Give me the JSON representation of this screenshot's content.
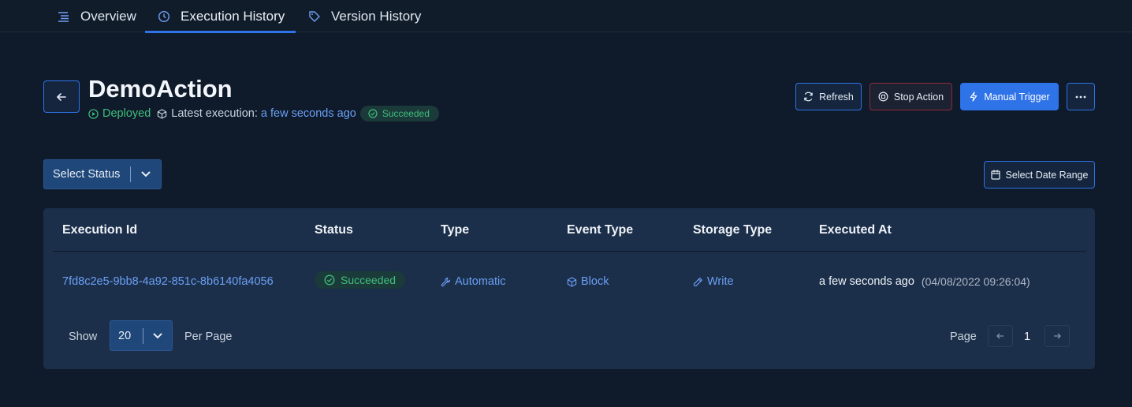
{
  "tabs": [
    {
      "label": "Overview",
      "icon": "list-icon",
      "active": false
    },
    {
      "label": "Execution History",
      "icon": "clock-icon",
      "active": true
    },
    {
      "label": "Version History",
      "icon": "tag-icon",
      "active": false
    }
  ],
  "header": {
    "title": "DemoAction",
    "deployed_label": "Deployed",
    "latest_label": "Latest execution:",
    "latest_time": "a few seconds ago",
    "latest_status": "Succeeded"
  },
  "actions": {
    "refresh": "Refresh",
    "stop": "Stop Action",
    "trigger": "Manual Trigger",
    "more": "more-icon"
  },
  "filters": {
    "status_placeholder": "Select Status",
    "date_range": "Select Date Range"
  },
  "table": {
    "columns": [
      "Execution Id",
      "Status",
      "Type",
      "Event Type",
      "Storage Type",
      "Executed At"
    ],
    "rows": [
      {
        "execution_id": "7fd8c2e5-9bb8-4a92-851c-8b6140fa4056",
        "status": "Succeeded",
        "type": "Automatic",
        "event_type": "Block",
        "storage_type": "Write",
        "executed_at": "a few seconds ago",
        "executed_at_exact": "(04/08/2022 09:26:04)"
      }
    ]
  },
  "pagination": {
    "show_label": "Show",
    "per_page_value": "20",
    "per_page_label": "Per Page",
    "page_label": "Page",
    "current_page": "1"
  },
  "colors": {
    "accent": "#2f73e8",
    "success": "#3fbf7c",
    "link": "#6aa0f5",
    "danger_border": "#8c2c3c"
  }
}
